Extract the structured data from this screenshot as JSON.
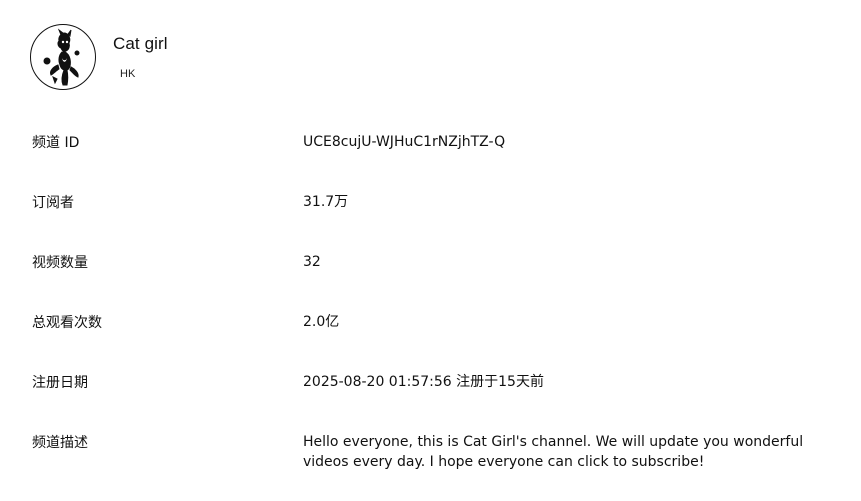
{
  "channel": {
    "name": "Cat girl",
    "region": "HK",
    "avatar_icon": "cat-girl-avatar-icon"
  },
  "details": {
    "channel_id": {
      "label": "频道 ID",
      "value": "UCE8cujU-WJHuC1rNZjhTZ-Q"
    },
    "subscribers": {
      "label": "订阅者",
      "value": "31.7万"
    },
    "video_count": {
      "label": "视频数量",
      "value": "32"
    },
    "total_views": {
      "label": "总观看次数",
      "value": "2.0亿"
    },
    "registered": {
      "label": "注册日期",
      "value": "2025-08-20 01:57:56 注册于15天前"
    },
    "description": {
      "label": "频道描述",
      "value": "Hello everyone, this is Cat Girl's channel. We will update you wonderful videos every day. I hope everyone can click to subscribe!"
    }
  }
}
